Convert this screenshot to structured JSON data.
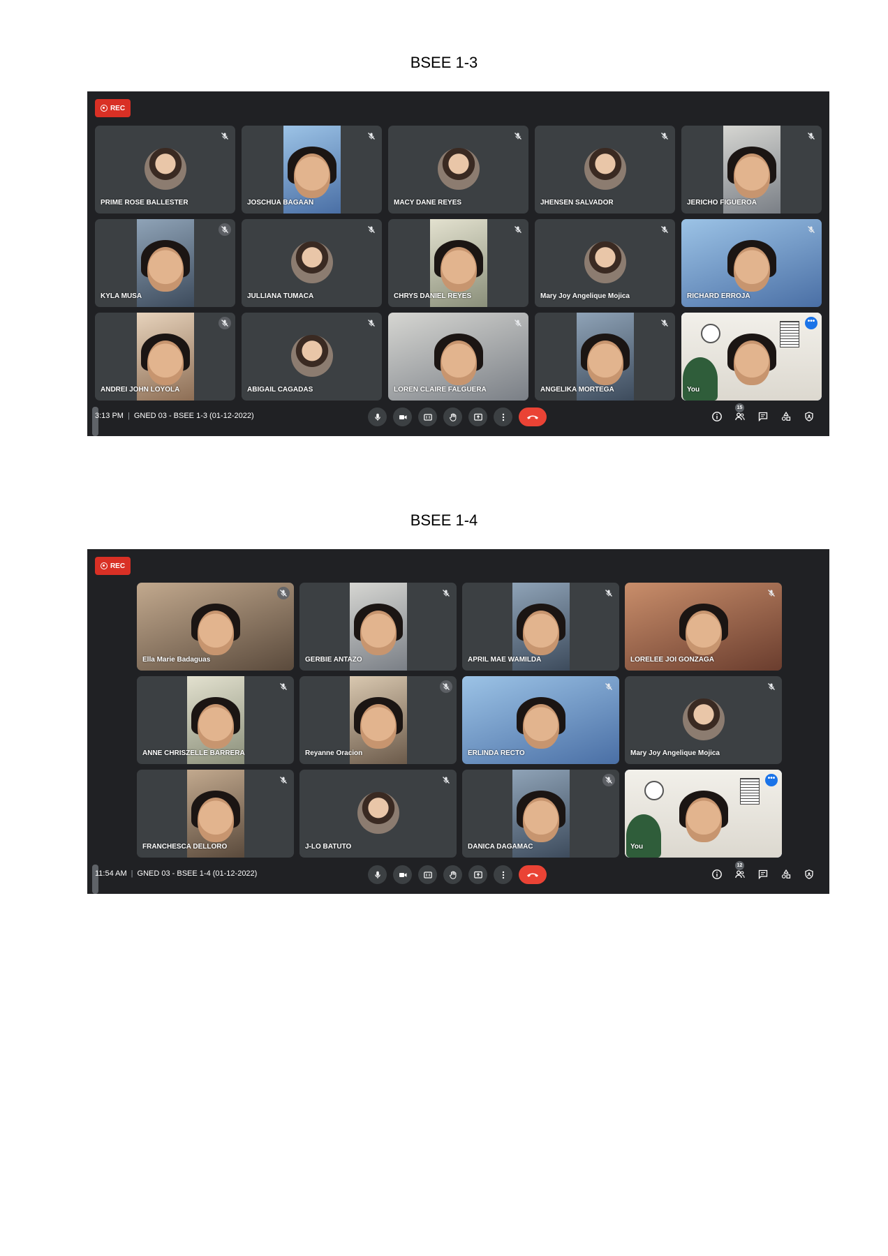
{
  "sections": [
    {
      "title": "BSEE 1-3",
      "rec_label": "REC",
      "time": "3:13 PM",
      "meeting_name": "GNED 03 - BSEE 1-3 (01-12-2022)",
      "participant_count": "15",
      "participants": [
        {
          "name": "PRIME ROSE BALLESTER",
          "style": "avatar",
          "muted": true
        },
        {
          "name": "JOSCHUA BAGAAN",
          "style": "video",
          "muted": true
        },
        {
          "name": "MACY DANE REYES",
          "style": "avatar",
          "muted": true
        },
        {
          "name": "JHENSEN SALVADOR",
          "style": "avatar",
          "muted": true
        },
        {
          "name": "JERICHO FIGUEROA",
          "style": "video",
          "muted": true
        },
        {
          "name": "KYLA MUSA",
          "style": "video",
          "muted": true
        },
        {
          "name": "JULLIANA TUMACA",
          "style": "avatar",
          "muted": true
        },
        {
          "name": "CHRYS DANIEL REYES",
          "style": "video",
          "muted": true
        },
        {
          "name": "Mary Joy Angelique Mojica",
          "style": "avatar",
          "muted": true
        },
        {
          "name": "RICHARD ERROJA",
          "style": "video",
          "muted": true
        },
        {
          "name": "ANDREI JOHN LOYOLA",
          "style": "video",
          "muted": true
        },
        {
          "name": "ABIGAIL CAGADAS",
          "style": "avatar",
          "muted": true
        },
        {
          "name": "LOREN CLAIRE FALGUERA",
          "style": "video",
          "muted": true
        },
        {
          "name": "ANGELIKA MORTEGA",
          "style": "video",
          "muted": true
        },
        {
          "name": "You",
          "style": "self",
          "muted": false
        }
      ]
    },
    {
      "title": "BSEE 1-4",
      "rec_label": "REC",
      "time": "11:54 AM",
      "meeting_name": "GNED 03 - BSEE 1-4 (01-12-2022)",
      "participant_count": "12",
      "participants": [
        {
          "name": "Ella Marie Badaguas",
          "style": "video",
          "muted": true
        },
        {
          "name": "GERBIE ANTAZO",
          "style": "video",
          "muted": true
        },
        {
          "name": "APRIL MAE WAMILDA",
          "style": "video",
          "muted": true
        },
        {
          "name": "LORELEE JOI GONZAGA",
          "style": "video",
          "muted": true
        },
        {
          "name": "ANNE CHRISZELLE BARRERA",
          "style": "video",
          "muted": true
        },
        {
          "name": "Reyanne Oracion",
          "style": "video",
          "muted": true
        },
        {
          "name": "ERLINDA RECTO",
          "style": "video",
          "muted": true
        },
        {
          "name": "Mary Joy Angelique Mojica",
          "style": "avatar",
          "muted": true
        },
        {
          "name": "FRANCHESCA DELLORO",
          "style": "video",
          "muted": true
        },
        {
          "name": "J-LO BATUTO",
          "style": "avatar",
          "muted": true
        },
        {
          "name": "DANICA DAGAMAC",
          "style": "video",
          "muted": true
        },
        {
          "name": "You",
          "style": "self",
          "muted": false
        }
      ]
    }
  ],
  "colors": {
    "meet_bg": "#202124",
    "tile_bg": "#3c4043",
    "rec_red": "#d93025",
    "end_call_red": "#ea4335",
    "self_outline": "#8ab4f8",
    "more_blue": "#1a73e8"
  },
  "icons": {
    "controls": [
      "mic-icon",
      "camera-icon",
      "captions-icon",
      "raise-hand-icon",
      "present-icon",
      "more-options-icon",
      "end-call-icon"
    ],
    "right": [
      "info-icon",
      "people-icon",
      "chat-icon",
      "activities-icon",
      "host-controls-icon"
    ]
  }
}
